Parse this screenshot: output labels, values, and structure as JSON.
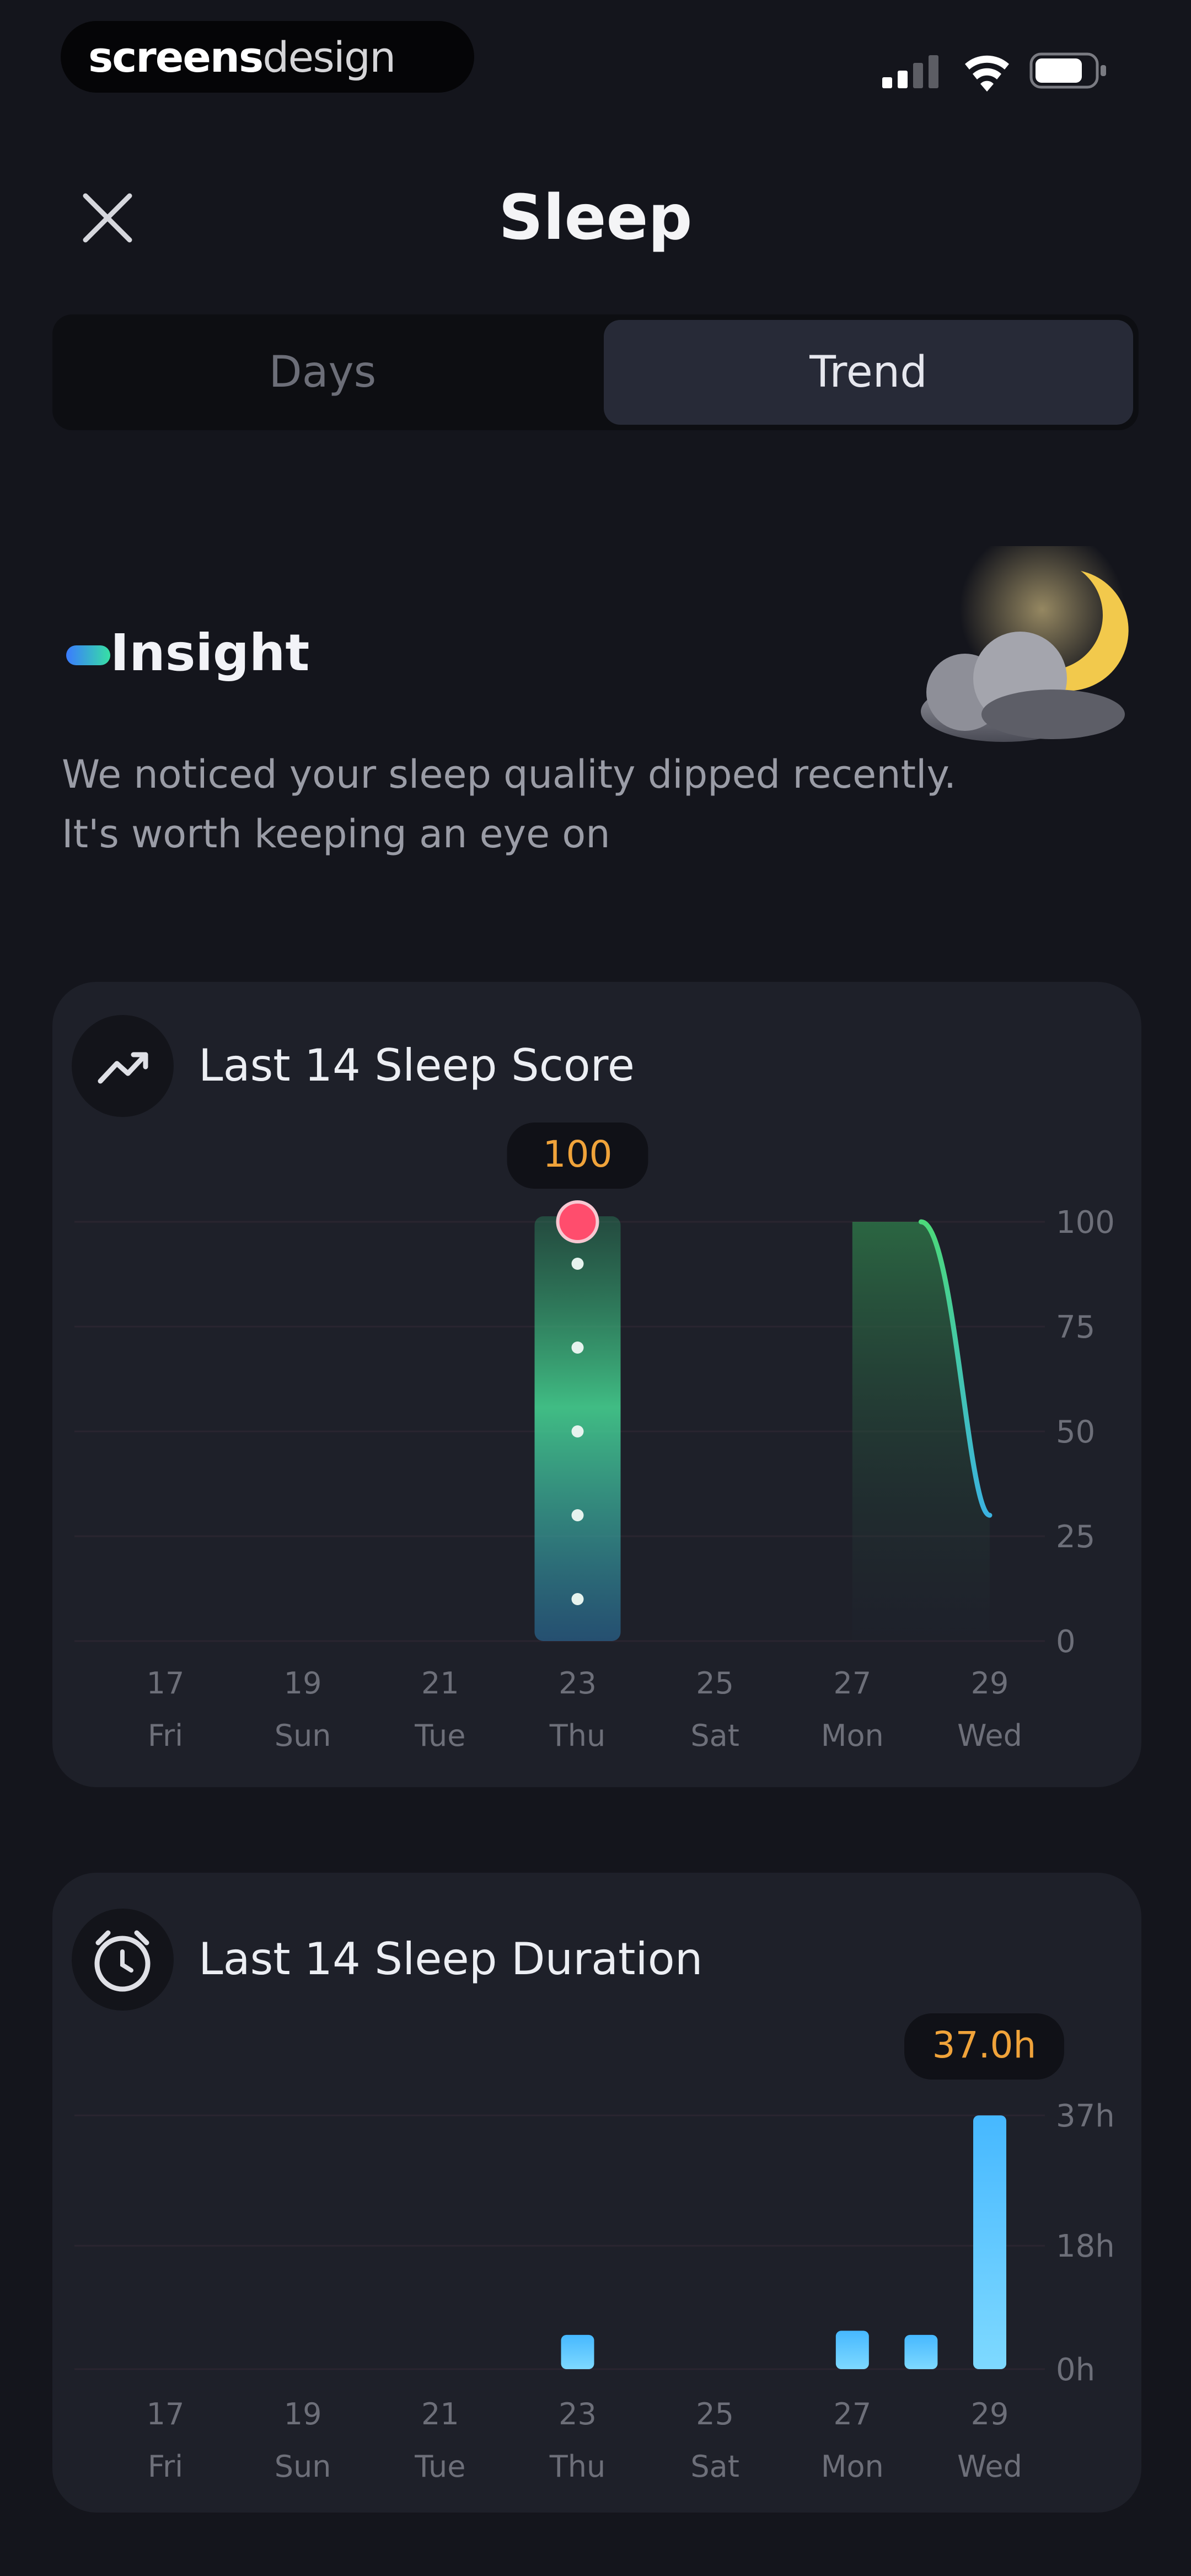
{
  "status_bar": {
    "brand_bold": "screens",
    "brand_light": "design"
  },
  "header": {
    "title": "Sleep",
    "close_icon": "close-icon"
  },
  "tabs": [
    {
      "label": "Days",
      "selected": false
    },
    {
      "label": "Trend",
      "selected": true
    }
  ],
  "insight": {
    "title": "Insight",
    "line1": "We noticed your sleep quality dipped recently.",
    "line2": "It's worth keeping an eye on"
  },
  "score_card": {
    "title": "Last 14 Sleep Score",
    "icon": "trend-up-icon",
    "callout": "100"
  },
  "duration_card": {
    "title": "Last 14 Sleep Duration",
    "icon": "alarm-clock-icon",
    "callout": "37.0h"
  },
  "colors": {
    "background": "#14151c",
    "card": "#1e2029",
    "accent_orange": "#f0a33a",
    "bar_blue": "#5cc8ff",
    "score_green": "#46d894"
  },
  "chart_data": [
    {
      "type": "area",
      "title": "Last 14 Sleep Score",
      "x_ticks": [
        {
          "day": "17",
          "weekday": "Fri"
        },
        {
          "day": "19",
          "weekday": "Sun"
        },
        {
          "day": "21",
          "weekday": "Tue"
        },
        {
          "day": "23",
          "weekday": "Thu"
        },
        {
          "day": "25",
          "weekday": "Sat"
        },
        {
          "day": "27",
          "weekday": "Mon"
        },
        {
          "day": "29",
          "weekday": "Wed"
        }
      ],
      "y_ticks": [
        "100",
        "75",
        "50",
        "25",
        "0"
      ],
      "ylim": [
        0,
        100
      ],
      "x": [
        23,
        27,
        28,
        29
      ],
      "y": [
        100,
        100,
        100,
        30
      ],
      "highlight": {
        "x": 23,
        "y": 100
      }
    },
    {
      "type": "bar",
      "title": "Last 14 Sleep Duration",
      "x_ticks": [
        {
          "day": "17",
          "weekday": "Fri"
        },
        {
          "day": "19",
          "weekday": "Sun"
        },
        {
          "day": "21",
          "weekday": "Tue"
        },
        {
          "day": "23",
          "weekday": "Thu"
        },
        {
          "day": "25",
          "weekday": "Sat"
        },
        {
          "day": "27",
          "weekday": "Mon"
        },
        {
          "day": "29",
          "weekday": "Wed"
        }
      ],
      "y_ticks": [
        "37h",
        "18h",
        "0h"
      ],
      "ylim": [
        0,
        37
      ],
      "x": [
        23,
        27,
        28,
        29
      ],
      "values": [
        5,
        5.6,
        5,
        37
      ],
      "highlight": {
        "x": 29,
        "y": 37
      }
    }
  ]
}
